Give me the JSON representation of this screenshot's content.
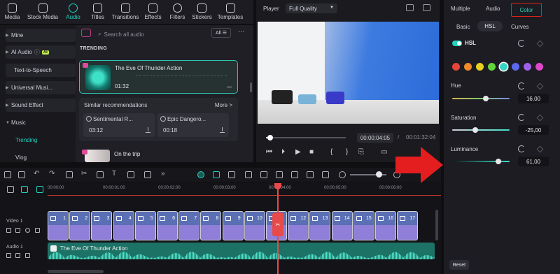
{
  "toolbar": {
    "items": [
      {
        "label": "Media"
      },
      {
        "label": "Stock Media"
      },
      {
        "label": "Audio"
      },
      {
        "label": "Titles"
      },
      {
        "label": "Transitions"
      },
      {
        "label": "Effects"
      },
      {
        "label": "Filters"
      },
      {
        "label": "Stickers"
      },
      {
        "label": "Templates"
      }
    ]
  },
  "sidebar": {
    "items": [
      {
        "label": "Mine"
      },
      {
        "label": "AI Audio"
      },
      {
        "label": "Text-to-Speech"
      },
      {
        "label": "Universal Musi..."
      },
      {
        "label": "Sound Effect"
      },
      {
        "label": "Music"
      },
      {
        "label": "Trending"
      },
      {
        "label": "Vlog"
      }
    ],
    "ai_badge": "AI"
  },
  "audio": {
    "search_placeholder": "Search all audio",
    "filter": "All",
    "section": "TRENDING",
    "featured": {
      "title": "The Eve Of Thunder Action",
      "duration": "01:32"
    },
    "similar_title": "Similar recommendations",
    "similar_more": "More >",
    "similar": [
      {
        "name": "Sentimental R...",
        "time": "03:12"
      },
      {
        "name": "Epic Dangero...",
        "time": "00:18"
      }
    ],
    "next_track": "On the trip"
  },
  "player": {
    "label": "Player",
    "quality": "Full Quality",
    "current_time": "00:00:04:05",
    "separator": "/",
    "total_time": "00:01:32:04",
    "progress": 0.05
  },
  "color_panel": {
    "tabs": [
      "Multiple",
      "Audio",
      "Color"
    ],
    "subtabs": [
      "Basic",
      "HSL",
      "Curves"
    ],
    "hsl_label": "HSL",
    "swatches": [
      "#e8443a",
      "#f08a2a",
      "#e8d020",
      "#63d43a",
      "#38d4c4",
      "#5a6af0",
      "#a060e8",
      "#e048c8"
    ],
    "selected_swatch": 4,
    "hue": {
      "label": "Hue",
      "value": "16,00",
      "level": 0.58
    },
    "saturation": {
      "label": "Saturation",
      "value": "-25,00",
      "level": 0.4
    },
    "luminance": {
      "label": "Luminance",
      "value": "61,00",
      "level": 0.8
    },
    "reset": "Reset"
  },
  "timeline": {
    "ticks": [
      "00:00:00",
      "00:00:01:00",
      "00:00:02:00",
      "00:00:03:00",
      "00:00:04:00",
      "00:00:05:00",
      "00:00:06:00"
    ],
    "video_label": "Video 1",
    "audio_label": "Audio 1",
    "clips": [
      "1",
      "2",
      "3",
      "4",
      "5",
      "6",
      "7",
      "8",
      "9",
      "10",
      "11",
      "12",
      "13",
      "14",
      "15",
      "16",
      "17"
    ],
    "audio_clip": "The Eve Of Thunder Action",
    "cut_clip": "12"
  }
}
